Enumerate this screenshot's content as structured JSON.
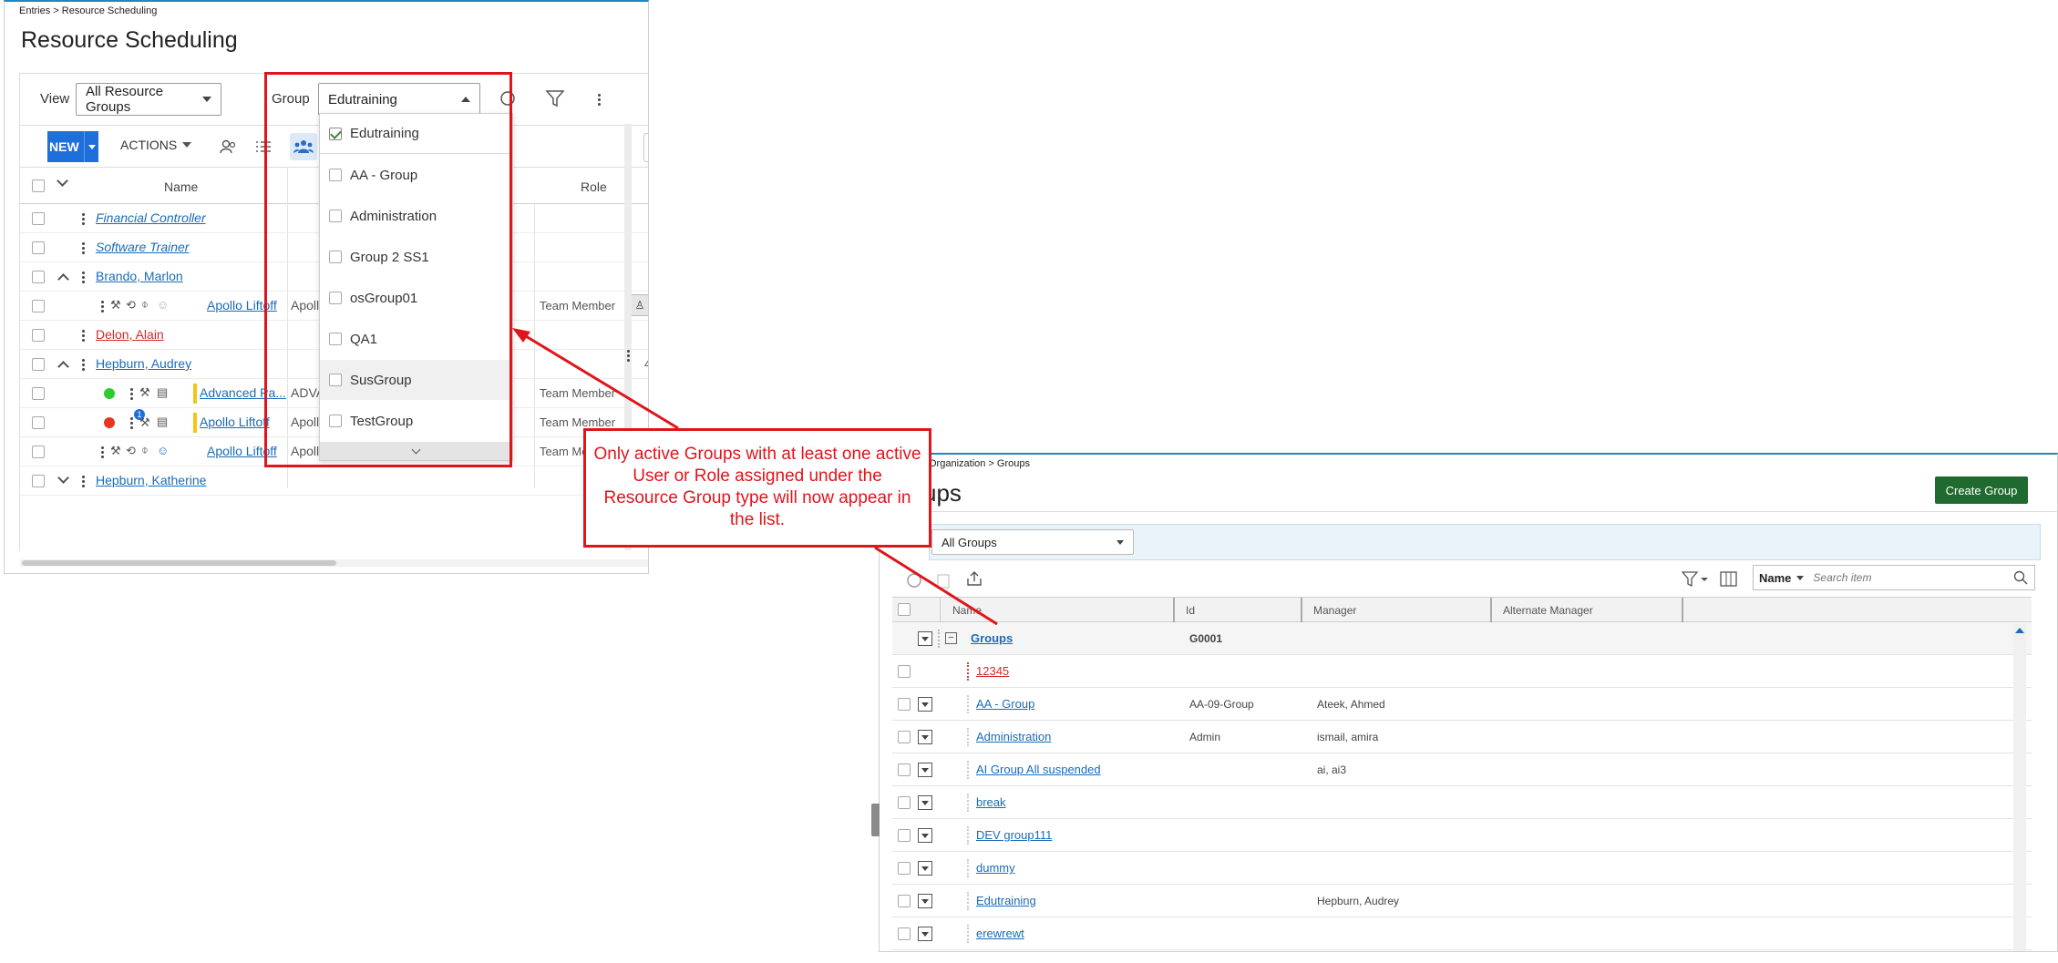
{
  "resource_scheduling": {
    "breadcrumb": "Entries > Resource Scheduling",
    "title": "Resource Scheduling",
    "view_label": "View",
    "view_value": "All Resource Groups",
    "group_label": "Group",
    "group_value": "Edutraining",
    "new_label": "NEW",
    "actions_label": "ACTIONS",
    "columns": {
      "name": "Name",
      "role": "Role"
    },
    "rows": [
      {
        "name": "Financial Controller"
      },
      {
        "name": "Software Trainer"
      },
      {
        "name": "Brando, Marlon"
      },
      {
        "name": "Apollo Liftoff",
        "col2": "Apollo",
        "role": "Team Member"
      },
      {
        "name": "Delon, Alain"
      },
      {
        "name": "Hepburn, Audrey"
      },
      {
        "name": "Advanced Pa...",
        "col2": "ADVA",
        "role": "Team Member"
      },
      {
        "name": "Apollo Liftoff",
        "col2": "Apollo",
        "role": "Team Member",
        "badge": "1"
      },
      {
        "name": "Apollo Liftoff",
        "col2": "Apollo Payrol",
        "role": "Team Me"
      },
      {
        "name": "Hepburn, Katherine"
      }
    ],
    "side_number": "4",
    "dropdown_items": [
      {
        "label": "Edutraining",
        "checked": true
      },
      {
        "label": "AA - Group"
      },
      {
        "label": "Administration"
      },
      {
        "label": "Group 2 SS1"
      },
      {
        "label": "osGroup01"
      },
      {
        "label": "QA1"
      },
      {
        "label": "SusGroup"
      },
      {
        "label": "TestGroup"
      }
    ]
  },
  "callout_text": "Only active Groups with at least one active User or Role assigned under the Resource Group type will now appear in the  list.",
  "groups_page": {
    "breadcrumb": "Organization > Groups",
    "title": "ups",
    "create_button": "Create Group",
    "filter_value": "All Groups",
    "search_field": "Name",
    "search_placeholder": "Search item",
    "columns": {
      "name": "Name",
      "id": "Id",
      "manager": "Manager",
      "alt_manager": "Alternate Manager"
    },
    "rows": [
      {
        "name": "Groups",
        "id": "G0001",
        "manager": ""
      },
      {
        "name": "12345",
        "id": "",
        "manager": ""
      },
      {
        "name": "AA - Group",
        "id": "AA-09-Group",
        "manager": "Ateek, Ahmed"
      },
      {
        "name": "Administration",
        "id": "Admin",
        "manager": "ismail, amira"
      },
      {
        "name": "AI Group All suspended",
        "id": "",
        "manager": "ai, ai3"
      },
      {
        "name": "break",
        "id": "",
        "manager": ""
      },
      {
        "name": "DEV group111",
        "id": "",
        "manager": ""
      },
      {
        "name": "dummy",
        "id": "",
        "manager": ""
      },
      {
        "name": "Edutraining",
        "id": "",
        "manager": "Hepburn, Audrey"
      },
      {
        "name": "erewrewt",
        "id": "",
        "manager": ""
      }
    ]
  },
  "colors": {
    "accent": "#1e6fd9",
    "callout": "#e0141c",
    "create": "#1f6b2f"
  }
}
